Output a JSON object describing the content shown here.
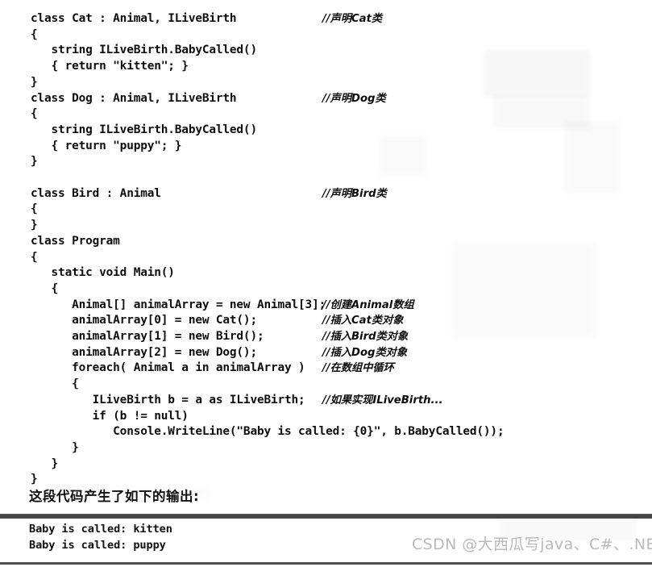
{
  "code_listing": {
    "language": "csharp",
    "lines": [
      {
        "text": "class Cat : Animal, ILiveBirth",
        "comment": "//声明Cat类"
      },
      {
        "text": "{",
        "comment": ""
      },
      {
        "text": "   string ILiveBirth.BabyCalled()",
        "comment": ""
      },
      {
        "text": "   { return \"kitten\"; }",
        "comment": ""
      },
      {
        "text": "}",
        "comment": ""
      },
      {
        "text": "class Dog : Animal, ILiveBirth",
        "comment": "//声明Dog类"
      },
      {
        "text": "{",
        "comment": ""
      },
      {
        "text": "   string ILiveBirth.BabyCalled()",
        "comment": ""
      },
      {
        "text": "   { return \"puppy\"; }",
        "comment": ""
      },
      {
        "text": "}",
        "comment": ""
      },
      {
        "text": "",
        "comment": ""
      },
      {
        "text": "class Bird : Animal",
        "comment": "//声明Bird类"
      },
      {
        "text": "{",
        "comment": ""
      },
      {
        "text": "}",
        "comment": ""
      },
      {
        "text": "class Program",
        "comment": ""
      },
      {
        "text": "{",
        "comment": ""
      },
      {
        "text": "   static void Main()",
        "comment": ""
      },
      {
        "text": "   {",
        "comment": ""
      },
      {
        "text": "      Animal[] animalArray = new Animal[3];",
        "comment": "//创建Animal数组"
      },
      {
        "text": "      animalArray[0] = new Cat();",
        "comment": "//插入Cat类对象"
      },
      {
        "text": "      animalArray[1] = new Bird();",
        "comment": "//插入Bird类对象"
      },
      {
        "text": "      animalArray[2] = new Dog();",
        "comment": "//插入Dog类对象"
      },
      {
        "text": "      foreach( Animal a in animalArray )",
        "comment": "//在数组中循环"
      },
      {
        "text": "      {",
        "comment": ""
      },
      {
        "text": "         ILiveBirth b = a as ILiveBirth;",
        "comment": "//如果实现ILiveBirth..."
      },
      {
        "text": "         if (b != null)",
        "comment": ""
      },
      {
        "text": "            Console.WriteLine(\"Baby is called: {0}\", b.BabyCalled());",
        "comment": ""
      },
      {
        "text": "      }",
        "comment": ""
      },
      {
        "text": "   }",
        "comment": ""
      },
      {
        "text": "}",
        "comment": ""
      }
    ]
  },
  "narrative": {
    "text": "这段代码产生了如下的输出:"
  },
  "console_output": {
    "lines": [
      "Baby is called: kitten",
      "Baby is called: puppy"
    ]
  },
  "watermark": {
    "text": "CSDN @大西瓜写java、C#、.NET"
  },
  "colors": {
    "page_background": "#ffffff",
    "text": "#111111",
    "separator_bar": "#4a4a4a",
    "watermark": "#b9b9b9"
  }
}
